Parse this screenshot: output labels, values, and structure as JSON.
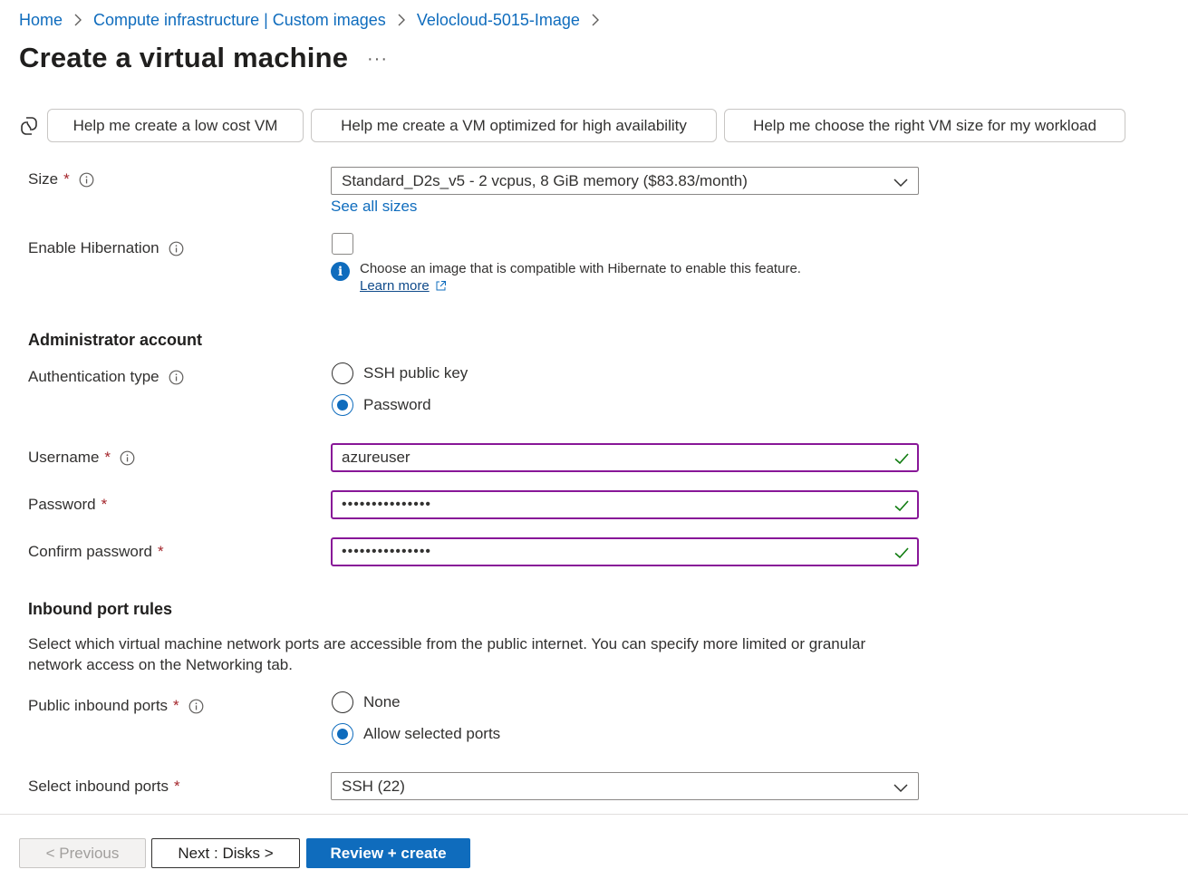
{
  "breadcrumb": [
    {
      "label": "Home"
    },
    {
      "label": "Compute infrastructure | Custom images"
    },
    {
      "label": "Velocloud-5015-Image"
    }
  ],
  "page": {
    "title": "Create a virtual machine",
    "more": "···"
  },
  "copilot": {
    "suggestions": [
      "Help me create a low cost VM",
      "Help me create a VM optimized for high availability",
      "Help me choose the right VM size for my workload"
    ]
  },
  "form": {
    "size": {
      "label": "Size",
      "required": "*",
      "value": "Standard_D2s_v5 - 2 vcpus, 8 GiB memory ($83.83/month)",
      "see_all": "See all sizes"
    },
    "hibernation": {
      "label": "Enable Hibernation",
      "checked": false,
      "info_message": "Choose an image that is compatible with Hibernate to enable this feature.",
      "learn_more": "Learn more"
    },
    "admin": {
      "section_title": "Administrator account",
      "auth_type": {
        "label": "Authentication type",
        "options": [
          "SSH public key",
          "Password"
        ],
        "selected": "Password"
      },
      "username": {
        "label": "Username",
        "required": "*",
        "value": "azureuser"
      },
      "password": {
        "label": "Password",
        "required": "*",
        "value": "•••••••••••••••"
      },
      "confirm_password": {
        "label": "Confirm password",
        "required": "*",
        "value": "•••••••••••••••"
      }
    },
    "inbound": {
      "section_title": "Inbound port rules",
      "description": "Select which virtual machine network ports are accessible from the public internet. You can specify more limited or granular network access on the Networking tab.",
      "public_ports": {
        "label": "Public inbound ports",
        "required": "*",
        "options": [
          "None",
          "Allow selected ports"
        ],
        "selected": "Allow selected ports"
      },
      "select_ports": {
        "label": "Select inbound ports",
        "required": "*",
        "value": "SSH (22)"
      }
    }
  },
  "footer": {
    "previous": "< Previous",
    "next": "Next : Disks >",
    "review": "Review + create"
  },
  "colors": {
    "accent": "#0f6cbd",
    "valid_border": "#881798",
    "valid_check": "#107c10",
    "required": "#a4262c"
  }
}
